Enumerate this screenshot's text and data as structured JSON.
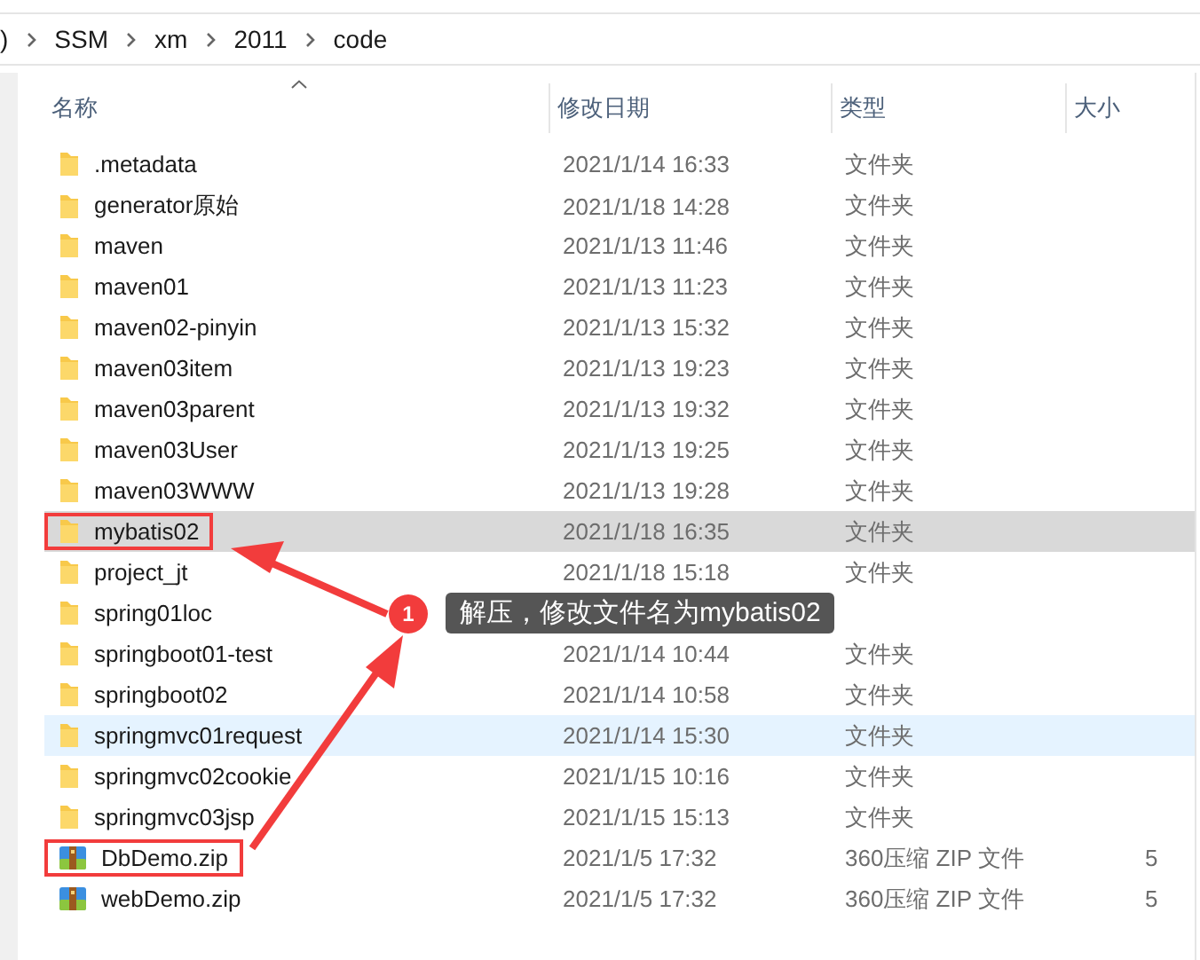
{
  "breadcrumb": [
    ")",
    "SSM",
    "xm",
    "2011",
    "code"
  ],
  "columns": [
    "名称",
    "修改日期",
    "类型",
    "大小"
  ],
  "rows": [
    {
      "kind": "folder",
      "name": ".metadata",
      "date": "2021/1/14 16:33",
      "type": "文件夹",
      "selected": false,
      "hovered": false,
      "annotated": false
    },
    {
      "kind": "folder",
      "name": "generator原始",
      "date": "2021/1/18 14:28",
      "type": "文件夹",
      "selected": false,
      "hovered": false,
      "annotated": false
    },
    {
      "kind": "folder",
      "name": "maven",
      "date": "2021/1/13 11:46",
      "type": "文件夹",
      "selected": false,
      "hovered": false,
      "annotated": false
    },
    {
      "kind": "folder",
      "name": "maven01",
      "date": "2021/1/13 11:23",
      "type": "文件夹",
      "selected": false,
      "hovered": false,
      "annotated": false
    },
    {
      "kind": "folder",
      "name": "maven02-pinyin",
      "date": "2021/1/13 15:32",
      "type": "文件夹",
      "selected": false,
      "hovered": false,
      "annotated": false
    },
    {
      "kind": "folder",
      "name": "maven03item",
      "date": "2021/1/13 19:23",
      "type": "文件夹",
      "selected": false,
      "hovered": false,
      "annotated": false
    },
    {
      "kind": "folder",
      "name": "maven03parent",
      "date": "2021/1/13 19:32",
      "type": "文件夹",
      "selected": false,
      "hovered": false,
      "annotated": false
    },
    {
      "kind": "folder",
      "name": "maven03User",
      "date": "2021/1/13 19:25",
      "type": "文件夹",
      "selected": false,
      "hovered": false,
      "annotated": false
    },
    {
      "kind": "folder",
      "name": "maven03WWW",
      "date": "2021/1/13 19:28",
      "type": "文件夹",
      "selected": false,
      "hovered": false,
      "annotated": false
    },
    {
      "kind": "folder",
      "name": "mybatis02",
      "date": "2021/1/18 16:35",
      "type": "文件夹",
      "selected": true,
      "hovered": false,
      "annotated": true
    },
    {
      "kind": "folder",
      "name": "project_jt",
      "date": "2021/1/18 15:18",
      "type": "文件夹",
      "selected": false,
      "hovered": false,
      "annotated": false
    },
    {
      "kind": "folder",
      "name": "spring01loc",
      "selected": false,
      "hovered": false,
      "annotated": false
    },
    {
      "kind": "folder",
      "name": "springboot01-test",
      "date": "2021/1/14 10:44",
      "type": "文件夹",
      "selected": false,
      "hovered": false,
      "annotated": false
    },
    {
      "kind": "folder",
      "name": "springboot02",
      "date": "2021/1/14 10:58",
      "type": "文件夹",
      "selected": false,
      "hovered": false,
      "annotated": false
    },
    {
      "kind": "folder",
      "name": "springmvc01request",
      "date": "2021/1/14 15:30",
      "type": "文件夹",
      "selected": false,
      "hovered": true,
      "annotated": false
    },
    {
      "kind": "folder",
      "name": "springmvc02cookie",
      "date": "2021/1/15 10:16",
      "type": "文件夹",
      "selected": false,
      "hovered": false,
      "annotated": false
    },
    {
      "kind": "folder",
      "name": "springmvc03jsp",
      "date": "2021/1/15 15:13",
      "type": "文件夹",
      "selected": false,
      "hovered": false,
      "annotated": false
    },
    {
      "kind": "zip",
      "name": "DbDemo.zip",
      "date": "2021/1/5 17:32",
      "type": "360压缩 ZIP 文件",
      "size": "5",
      "selected": false,
      "hovered": false,
      "annotated": true
    },
    {
      "kind": "zip",
      "name": "webDemo.zip",
      "date": "2021/1/5 17:32",
      "type": "360压缩 ZIP 文件",
      "size": "5",
      "selected": false,
      "hovered": false,
      "annotated": false
    }
  ],
  "callout": {
    "number": "1",
    "text": "解压，修改文件名为mybatis02"
  }
}
